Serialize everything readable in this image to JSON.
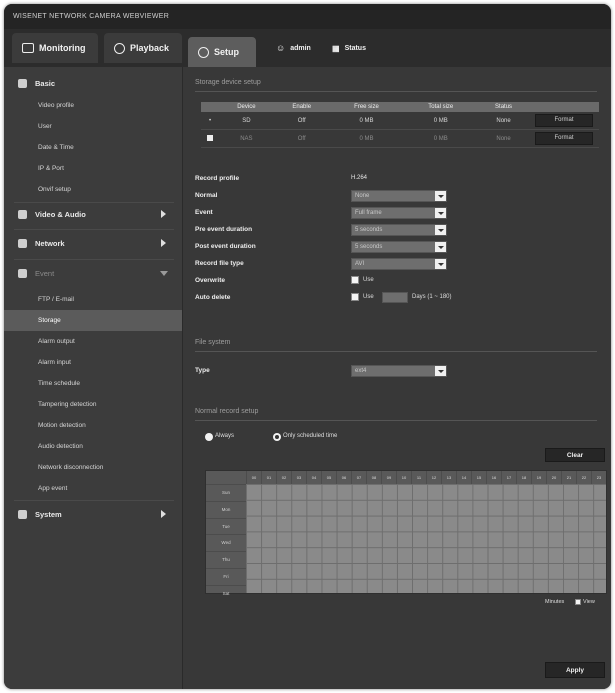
{
  "window": {
    "title": "WISENET NETWORK CAMERA WEBVIEWER"
  },
  "topnav": {
    "monitoring": "Monitoring",
    "playback": "Playback",
    "setup": "Setup",
    "admin": "admin",
    "status": "Status"
  },
  "sidebar": {
    "basic": "Basic",
    "basic_items": [
      "Video profile",
      "User",
      "Date & Time",
      "IP & Port",
      "Onvif setup"
    ],
    "video_audio": "Video & Audio",
    "network": "Network",
    "event": "Event",
    "event_items": [
      "FTP / E-mail",
      "Storage",
      "Alarm output",
      "Alarm input",
      "Time schedule",
      "Tampering detection",
      "Motion detection",
      "Audio detection",
      "Network disconnection",
      "App event"
    ],
    "system": "System",
    "active_item": "Storage"
  },
  "storage": {
    "section_title": "Storage device setup",
    "columns": [
      "Device",
      "Enable",
      "Free size",
      "Total size",
      "Status"
    ],
    "rows": [
      {
        "device": "SD",
        "enable": "Off",
        "free": "0 MB",
        "total": "0 MB",
        "status": "None",
        "action": "Format"
      },
      {
        "device": "NAS",
        "enable": "Off",
        "free": "0 MB",
        "total": "0 MB",
        "status": "None",
        "action": "Format"
      }
    ]
  },
  "fields": {
    "record_profile_label": "Record profile",
    "record_profile_value": "H.264",
    "normal_label": "Normal",
    "normal_value": "None",
    "event_label": "Event",
    "event_value": "Full frame",
    "pre_event_label": "Pre event duration",
    "pre_event_value": "5 seconds",
    "post_event_label": "Post event duration",
    "post_event_value": "5 seconds",
    "record_file_type_label": "Record file type",
    "record_file_type_value": "AVI",
    "overwrite_label": "Overwrite",
    "overwrite_text": "Use",
    "auto_delete_label": "Auto delete",
    "auto_delete_use": "Use",
    "auto_delete_days": "Days (1 ~ 180)"
  },
  "filesystem": {
    "section_title": "File system",
    "type_label": "Type",
    "type_value": "ext4"
  },
  "schedule": {
    "section_title": "Normal record setup",
    "always": "Always",
    "only_scheduled": "Only scheduled time",
    "clear": "Clear",
    "days": [
      "Sun",
      "Mon",
      "Tue",
      "Wed",
      "Thu",
      "Fri",
      "Sat"
    ],
    "hours": [
      "00",
      "01",
      "02",
      "03",
      "04",
      "05",
      "06",
      "07",
      "08",
      "09",
      "10",
      "11",
      "12",
      "13",
      "14",
      "15",
      "16",
      "17",
      "18",
      "19",
      "20",
      "21",
      "22",
      "23"
    ],
    "minutes_label": "Minutes",
    "view_label": "View"
  },
  "apply": "Apply"
}
